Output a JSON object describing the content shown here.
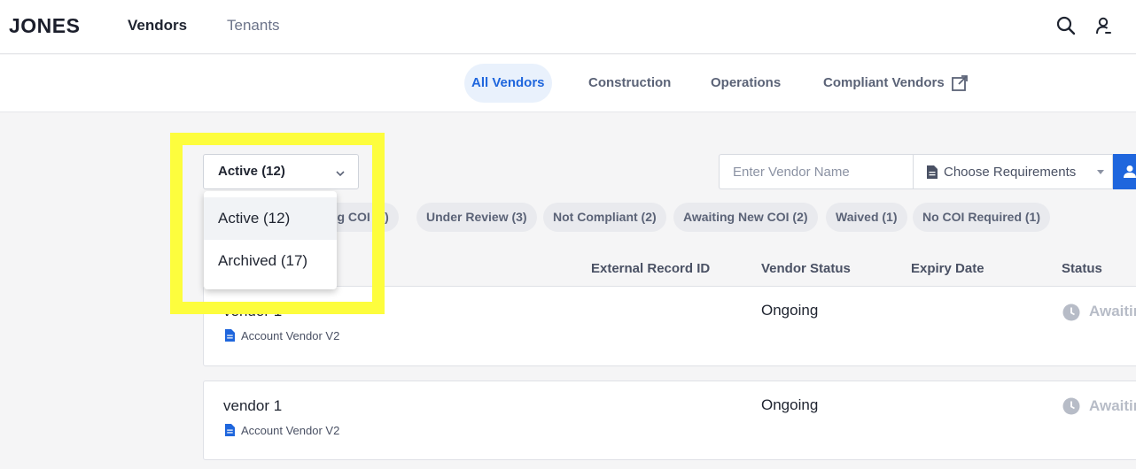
{
  "header": {
    "logo": "JONES",
    "nav": [
      {
        "label": "Vendors",
        "active": true
      },
      {
        "label": "Tenants",
        "active": false
      }
    ],
    "icons": [
      "search-icon",
      "user-icon"
    ]
  },
  "subnav": {
    "tabs": [
      {
        "label": "All Vendors",
        "active": true
      },
      {
        "label": "Construction",
        "active": false
      },
      {
        "label": "Operations",
        "active": false
      },
      {
        "label": "Compliant Vendors",
        "active": false,
        "icon": "external-link-icon"
      }
    ]
  },
  "filters": {
    "status_select": {
      "value": "Active (12)"
    },
    "status_options": [
      "Active (12)",
      "Archived (17)"
    ],
    "search": {
      "placeholder": "Enter Vendor Name",
      "value": ""
    },
    "requirements": {
      "label": "Choose Requirements"
    },
    "chips": [
      "ing COI (3)",
      "Under Review (3)",
      "Not Compliant (2)",
      "Awaiting New COI (2)",
      "Waived (1)",
      "No COI Required (1)"
    ]
  },
  "table": {
    "columns": [
      "External Record ID",
      "Vendor Status",
      "Expiry Date",
      "Status"
    ],
    "rows": [
      {
        "name": "vendor 1",
        "requirement": "Account Vendor V2",
        "external_id": "",
        "vendor_status": "Ongoing",
        "expiry": "",
        "status": "Awaitin"
      },
      {
        "name": "vendor 1",
        "requirement": "Account Vendor V2",
        "external_id": "",
        "vendor_status": "Ongoing",
        "expiry": "",
        "status": "Awaitin"
      }
    ]
  },
  "colors": {
    "accent": "#1f66dd",
    "highlight": "#fdfd3d",
    "chip_bg": "#e9eaee",
    "muted_status": "#b7bcc7"
  }
}
